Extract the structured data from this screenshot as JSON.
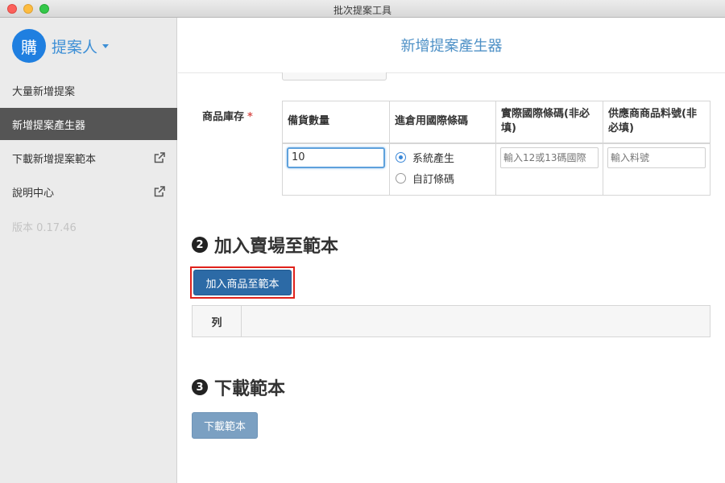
{
  "window": {
    "title": "批次提案工具"
  },
  "sidebar": {
    "avatar_text": "購",
    "brand_name": "提案人",
    "items": [
      {
        "label": "大量新增提案",
        "external": false
      },
      {
        "label": "新增提案產生器",
        "external": false,
        "active": true
      },
      {
        "label": "下載新增提案範本",
        "external": true
      },
      {
        "label": "說明中心",
        "external": true
      }
    ],
    "version": "版本 0.17.46"
  },
  "main": {
    "page_title": "新增提案產生器",
    "stock": {
      "label": "商品庫存",
      "required_mark": "*",
      "headers": [
        "備貨數量",
        "進倉用國際條碼",
        "實際國際條碼(非必填)",
        "供應商商品料號(非必填)"
      ],
      "quantity_value": "10",
      "barcode_options": [
        {
          "label": "系統產生",
          "selected": true
        },
        {
          "label": "自訂條碼",
          "selected": false
        }
      ],
      "barcode_placeholder": "輸入12或13碼國際",
      "part_number_placeholder": "輸入料號"
    },
    "section2": {
      "number": "2",
      "title": "加入賣場至範本"
    },
    "add_button_label": "加入商品至範本",
    "list_header": {
      "col1": "列"
    },
    "section3": {
      "number": "3",
      "title": "下載範本"
    },
    "download_button_label": "下載範本"
  },
  "colors": {
    "accent": "#4d90c6",
    "primary_button": "#2c6aa6",
    "disabled_button": "#7ba0c2",
    "highlight_border": "#e0221b",
    "active_nav": "#555555"
  }
}
